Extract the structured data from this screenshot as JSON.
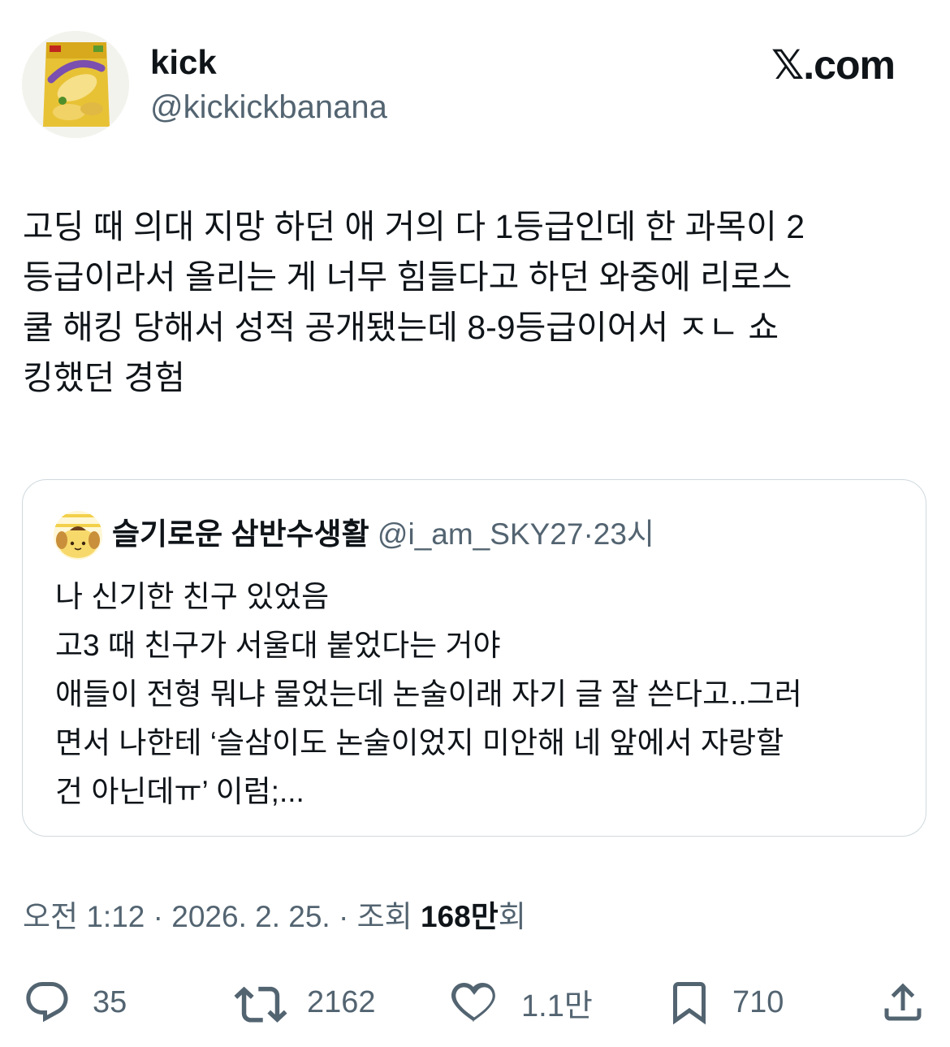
{
  "author": {
    "display_name": "kick",
    "handle": "@kickickbanana",
    "avatar_icon": "banana-snack-bag-avatar"
  },
  "site_logo": "𝕏.com",
  "tweet": {
    "text": "고딩 때 의대 지망 하던 애 거의 다 1등급인데 한 과목이 2\n등급이라서 올리는 게 너무 힘들다고 하던 와중에 리로스\n쿨 해킹 당해서 성적 공개됐는데 8-9등급이어서 ㅈㄴ 쇼\n킹했던 경험"
  },
  "quote": {
    "display_name": "슬기로운 삼반수생활",
    "handle": "@i_am_SKY27",
    "separator": "·",
    "time": "23시",
    "avatar_icon": "pompompurin-avatar",
    "text": "나 신기한 친구 있었음\n고3 때 친구가 서울대 붙었다는 거야\n애들이 전형 뭐냐 물었는데 논술이래 자기 글 잘 쓴다고..그러\n면서 나한테 ‘슬삼이도 논술이었지 미안해 네 앞에서 자랑할\n건 아닌데ㅠ’ 이럼;..."
  },
  "meta": {
    "time": "오전 1:12",
    "sep1": "·",
    "date": "2026. 2. 25.",
    "sep2": "·",
    "views_label": "조회",
    "views_count": "168만",
    "views_suffix": "회"
  },
  "actions": {
    "reply_count": "35",
    "retweet_count": "2162",
    "like_count": "1.1만",
    "bookmark_count": "710"
  },
  "colors": {
    "text": "#0f1419",
    "muted": "#536471",
    "border": "#cfd9de"
  }
}
